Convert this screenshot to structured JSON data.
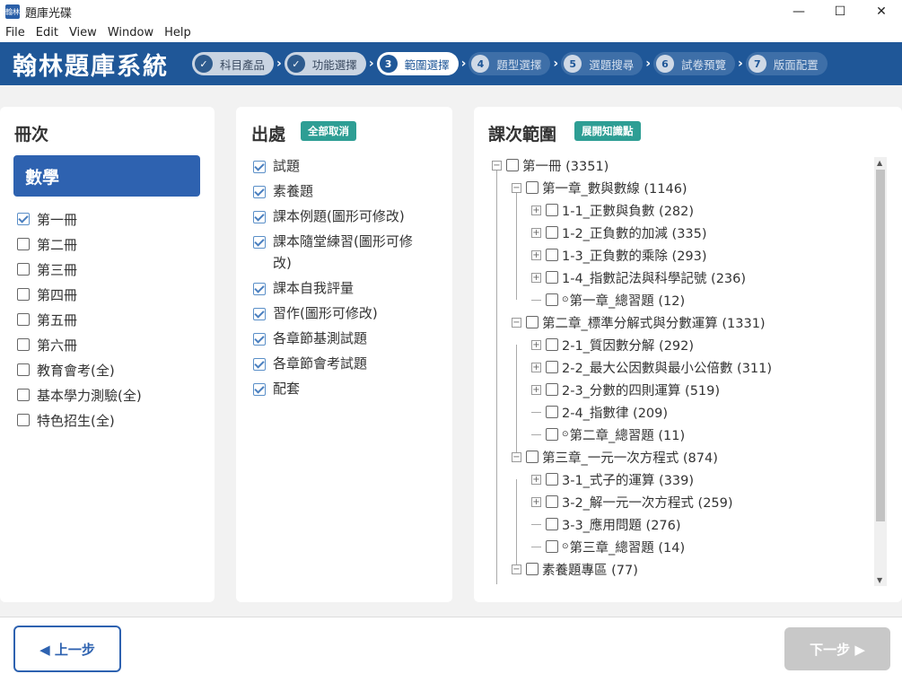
{
  "window": {
    "title": "題庫光碟",
    "icon_label": "翰林",
    "minimize": "—",
    "maximize": "☐",
    "close": "✕"
  },
  "menu": [
    "File",
    "Edit",
    "View",
    "Window",
    "Help"
  ],
  "header": {
    "brand": "翰林題庫系統",
    "steps": [
      {
        "num": "✓",
        "label": "科目產品",
        "state": "done"
      },
      {
        "num": "✓",
        "label": "功能選擇",
        "state": "done"
      },
      {
        "num": "3",
        "label": "範圍選擇",
        "state": "active"
      },
      {
        "num": "4",
        "label": "題型選擇",
        "state": "todo"
      },
      {
        "num": "5",
        "label": "選題搜尋",
        "state": "todo"
      },
      {
        "num": "6",
        "label": "試卷預覽",
        "state": "todo"
      },
      {
        "num": "7",
        "label": "版面配置",
        "state": "todo"
      }
    ],
    "separator": "›"
  },
  "volumes": {
    "title": "冊次",
    "subject": "數學",
    "items": [
      {
        "label": "第一冊",
        "checked": true
      },
      {
        "label": "第二冊",
        "checked": false
      },
      {
        "label": "第三冊",
        "checked": false
      },
      {
        "label": "第四冊",
        "checked": false
      },
      {
        "label": "第五冊",
        "checked": false
      },
      {
        "label": "第六冊",
        "checked": false
      },
      {
        "label": "教育會考(全)",
        "checked": false
      },
      {
        "label": "基本學力測驗(全)",
        "checked": false
      },
      {
        "label": "特色招生(全)",
        "checked": false
      }
    ]
  },
  "sources": {
    "title": "出處",
    "cancel_all": "全部取消",
    "items": [
      {
        "label": "試題",
        "checked": true
      },
      {
        "label": "素養題",
        "checked": true
      },
      {
        "label": "課本例題(圖形可修改)",
        "checked": true
      },
      {
        "label": "課本隨堂練習(圖形可修",
        "label2": "改)",
        "checked": true
      },
      {
        "label": "課本自我評量",
        "checked": true
      },
      {
        "label": "習作(圖形可修改)",
        "checked": true
      },
      {
        "label": "各章節基測試題",
        "checked": true
      },
      {
        "label": "各章節會考試題",
        "checked": true
      },
      {
        "label": "配套",
        "checked": true
      }
    ]
  },
  "range": {
    "title": "課次範圍",
    "expand_btn": "展開知識點",
    "tree": [
      {
        "level": 0,
        "exp": "−",
        "mark": "",
        "label": "第一冊 (3351)"
      },
      {
        "level": 1,
        "exp": "−",
        "mark": "",
        "label": "第一章_數與數線 (1146)"
      },
      {
        "level": 2,
        "exp": "+",
        "mark": "",
        "label": "1-1_正數與負數 (282)"
      },
      {
        "level": 2,
        "exp": "+",
        "mark": "",
        "label": "1-2_正負數的加減 (335)"
      },
      {
        "level": 2,
        "exp": "+",
        "mark": "",
        "label": "1-3_正負數的乘除 (293)"
      },
      {
        "level": 2,
        "exp": "+",
        "mark": "",
        "label": "1-4_指數記法與科學記號 (236)"
      },
      {
        "level": 2,
        "exp": "",
        "mark": "⊙",
        "label": "第一章_總習題 (12)"
      },
      {
        "level": 1,
        "exp": "−",
        "mark": "",
        "label": "第二章_標準分解式與分數運算 (1331)"
      },
      {
        "level": 2,
        "exp": "+",
        "mark": "",
        "label": "2-1_質因數分解 (292)"
      },
      {
        "level": 2,
        "exp": "+",
        "mark": "",
        "label": "2-2_最大公因數與最小公倍數 (311)"
      },
      {
        "level": 2,
        "exp": "+",
        "mark": "",
        "label": "2-3_分數的四則運算 (519)"
      },
      {
        "level": 2,
        "exp": "",
        "mark": "",
        "label": "2-4_指數律 (209)"
      },
      {
        "level": 2,
        "exp": "",
        "mark": "⊙",
        "label": "第二章_總習題 (11)"
      },
      {
        "level": 1,
        "exp": "−",
        "mark": "",
        "label": "第三章_一元一次方程式 (874)"
      },
      {
        "level": 2,
        "exp": "+",
        "mark": "",
        "label": "3-1_式子的運算 (339)"
      },
      {
        "level": 2,
        "exp": "+",
        "mark": "",
        "label": "3-2_解一元一次方程式 (259)"
      },
      {
        "level": 2,
        "exp": "",
        "mark": "",
        "label": "3-3_應用問題 (276)"
      },
      {
        "level": 2,
        "exp": "",
        "mark": "⊙",
        "label": "第三章_總習題 (14)"
      },
      {
        "level": 1,
        "exp": "−",
        "mark": "",
        "label": "素養題專區 (77)"
      }
    ],
    "scroll_up": "▲",
    "scroll_down": "▼"
  },
  "footer": {
    "prev": "◀ 上一步",
    "next": "下一步 ▶"
  }
}
